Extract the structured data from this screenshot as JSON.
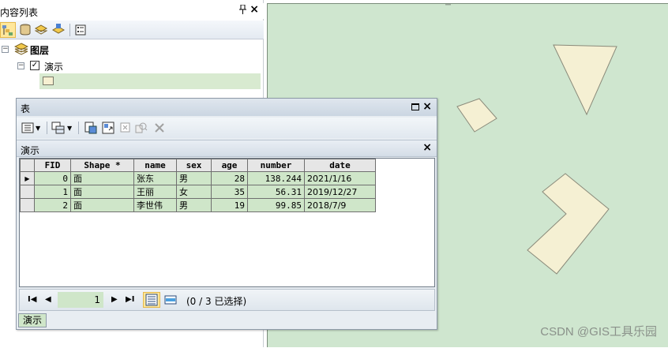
{
  "toc": {
    "title": "内容列表",
    "pin_glyph": "ᵼ",
    "close_glyph": "×",
    "tree": {
      "root_label": "图层",
      "layer_label": "演示",
      "layer_checked": true,
      "expander_root": "−",
      "expander_layer": "−"
    }
  },
  "table_window": {
    "title": "表",
    "close_glyph": "×",
    "layer_tab": "演示",
    "columns": [
      "FID",
      "Shape *",
      "name",
      "sex",
      "age",
      "number",
      "date"
    ],
    "rows": [
      {
        "FID": "0",
        "Shape": "面",
        "name": "张东",
        "sex": "男",
        "age": "28",
        "number": "138.244",
        "date": "2021/1/16",
        "current": true
      },
      {
        "FID": "1",
        "Shape": "面",
        "name": "王丽",
        "sex": "女",
        "age": "35",
        "number": "56.31",
        "date": "2019/12/27",
        "current": false
      },
      {
        "FID": "2",
        "Shape": "面",
        "name": "李世伟",
        "sex": "男",
        "age": "19",
        "number": "99.85",
        "date": "2018/7/9",
        "current": false
      }
    ],
    "current_record": "1",
    "selection_status": "(0 / 3 已选择)",
    "bottom_tab": "演示"
  },
  "map": {
    "background_color": "#cfe6cf",
    "feature_fill": "#f5f0d3",
    "watermark": "CSDN @GIS工具乐园"
  },
  "colors": {
    "grid_cell": "#cfe6c9",
    "active_button": "#ffe79b"
  }
}
